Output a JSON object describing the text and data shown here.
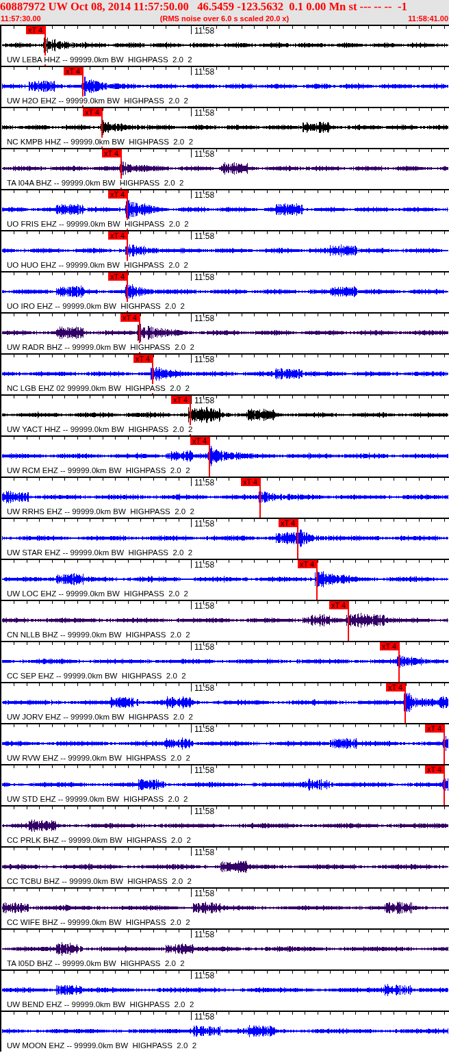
{
  "header": {
    "title": "60887972 UW Oct 08, 2014 11:57:50.00   46.5459 -123.5632  0.1 0.00 Mn st --- -- --  -1",
    "start_time": "11:57:30.00",
    "note": "(RMS noise over 6.0 s scaled 20.0 x)",
    "end_time": "11:58:41.00"
  },
  "traces": [
    {
      "label": "UW LEBA HHZ -- 99999.0km BW  HIGHPASS  2.0  2",
      "time_label": "11:58",
      "color": "#000000",
      "pick": {
        "label": "xT 4",
        "level": 0.099
      }
    },
    {
      "label": "UW H2O EHZ -- 99999.0km BW  HIGHPASS  2.0  2",
      "time_label": "11:58",
      "color": "#0000ff",
      "pick": {
        "label": "xT 4",
        "level": 0.183
      }
    },
    {
      "label": "NC KMPB HHZ -- 99999.0km BW  HIGHPASS  2.0  2",
      "time_label": "11:58",
      "color": "#000000",
      "pick": {
        "label": "xT 4",
        "level": 0.226
      }
    },
    {
      "label": "TA I04A BHZ -- 99999.0km BW  HIGHPASS  2.0  2",
      "time_label": "11:58",
      "color": "#330066",
      "pick": {
        "label": "xT 4",
        "level": 0.268
      }
    },
    {
      "label": "UO FRIS EHZ -- 99999.0km BW  HIGHPASS  2.0  2",
      "time_label": "11:58",
      "color": "#0000ff",
      "pick": {
        "label": "xT 4",
        "level": 0.282
      }
    },
    {
      "label": "UO HUO EHZ -- 99999.0km BW  HIGHPASS  2.0  2",
      "time_label": "11:58",
      "color": "#0000ff",
      "pick": {
        "label": "xT 4",
        "level": 0.282
      }
    },
    {
      "label": "UO IRO EHZ -- 99999.0km BW  HIGHPASS  2.0  2",
      "time_label": "11:58",
      "color": "#0000ff",
      "pick": {
        "label": "xT 4",
        "level": 0.282
      }
    },
    {
      "label": "UW RADR BHZ -- 99999.0km BW  HIGHPASS  2.0  2",
      "time_label": "11:58",
      "color": "#330066",
      "pick": {
        "label": "xT 4",
        "level": 0.309
      }
    },
    {
      "label": "NC LGB EHZ 02 99999.0km BW  HIGHPASS  2.0  2",
      "time_label": "11:58",
      "color": "#0000ff",
      "pick": {
        "label": "xT 4",
        "level": 0.338
      }
    },
    {
      "label": "UW YACT HHZ -- 99999.0km BW  HIGHPASS  2.0  2",
      "time_label": "11:58",
      "color": "#000000",
      "pick": {
        "label": "xT 4",
        "level": 0.422
      }
    },
    {
      "label": "UW RCM EHZ -- 99999.0km BW  HIGHPASS  2.0  2",
      "color": "#0000ff",
      "pick": {
        "label": "xT 4",
        "level": 0.465
      }
    },
    {
      "label": "UW RRHS EHZ -- 99999.0km BW  HIGHPASS  2.0  2",
      "time_label": "11:58",
      "color": "#0000ff",
      "pick": {
        "label": "xT 4",
        "level": 0.578
      }
    },
    {
      "label": "UW STAR EHZ -- 99999.0km BW  HIGHPASS  2.0  2",
      "time_label": "11:58",
      "color": "#0000ff",
      "pick": {
        "label": "xT 4",
        "level": 0.662
      }
    },
    {
      "label": "UW LOC EHZ -- 99999.0km BW  HIGHPASS  2.0  2",
      "time_label": "11:58",
      "color": "#0000ff",
      "pick": {
        "label": "xT 4",
        "level": 0.704
      }
    },
    {
      "label": "CN NLLB BHZ -- 99999.0km BW  HIGHPASS  2.0  2",
      "time_label": "11:58",
      "color": "#330066",
      "pick": {
        "label": "xT 4",
        "level": 0.774
      }
    },
    {
      "label": "CC SEP EHZ -- 99999.0km BW  HIGHPASS  2.0  2",
      "time_label": "11:58",
      "color": "#0000ff",
      "pick": {
        "label": "xT 4",
        "level": 0.887
      }
    },
    {
      "label": "UW JORV EHZ -- 99999.0km BW  HIGHPASS  2.0  2",
      "time_label": "11:58",
      "color": "#0000ff",
      "pick": {
        "label": "xT 4",
        "level": 0.901
      }
    },
    {
      "label": "UW RVW EHZ -- 99999.0km BW  HIGHPASS  2.0  2",
      "time_label": "11:58",
      "color": "#0000ff",
      "pick": {
        "label": "xT 4",
        "level": 0.988
      }
    },
    {
      "label": "UW STD EHZ -- 99999.0km BW  HIGHPASS  2.0  2",
      "time_label": "11:58",
      "color": "#0000ff",
      "pick": {
        "label": "xT 4",
        "level": 0.988
      }
    },
    {
      "label": "CC PRLK BHZ -- 99999.0km BW  HIGHPASS  2.0  2",
      "time_label": "11:58",
      "color": "#330066"
    },
    {
      "label": "CC TCBU BHZ -- 99999.0km BW  HIGHPASS  2.0  2",
      "time_label": "11:58",
      "color": "#330066"
    },
    {
      "label": "CC WIFE BHZ -- 99999.0km BW  HIGHPASS  2.0  2",
      "time_label": "11:58",
      "color": "#330066"
    },
    {
      "label": "TA I05D BHZ -- 99999.0km BW  HIGHPASS  2.0  2",
      "time_label": "11:58",
      "color": "#330066"
    },
    {
      "label": "UW BEND EHZ -- 99999.0km BW  HIGHPASS  2.0  2",
      "time_label": "11:58",
      "color": "#0000ff"
    },
    {
      "label": "UW MOON EHZ -- 99999.0km BW  HIGHPASS  2.0  2",
      "time_label": "11:58",
      "color": "#0000ff"
    }
  ]
}
